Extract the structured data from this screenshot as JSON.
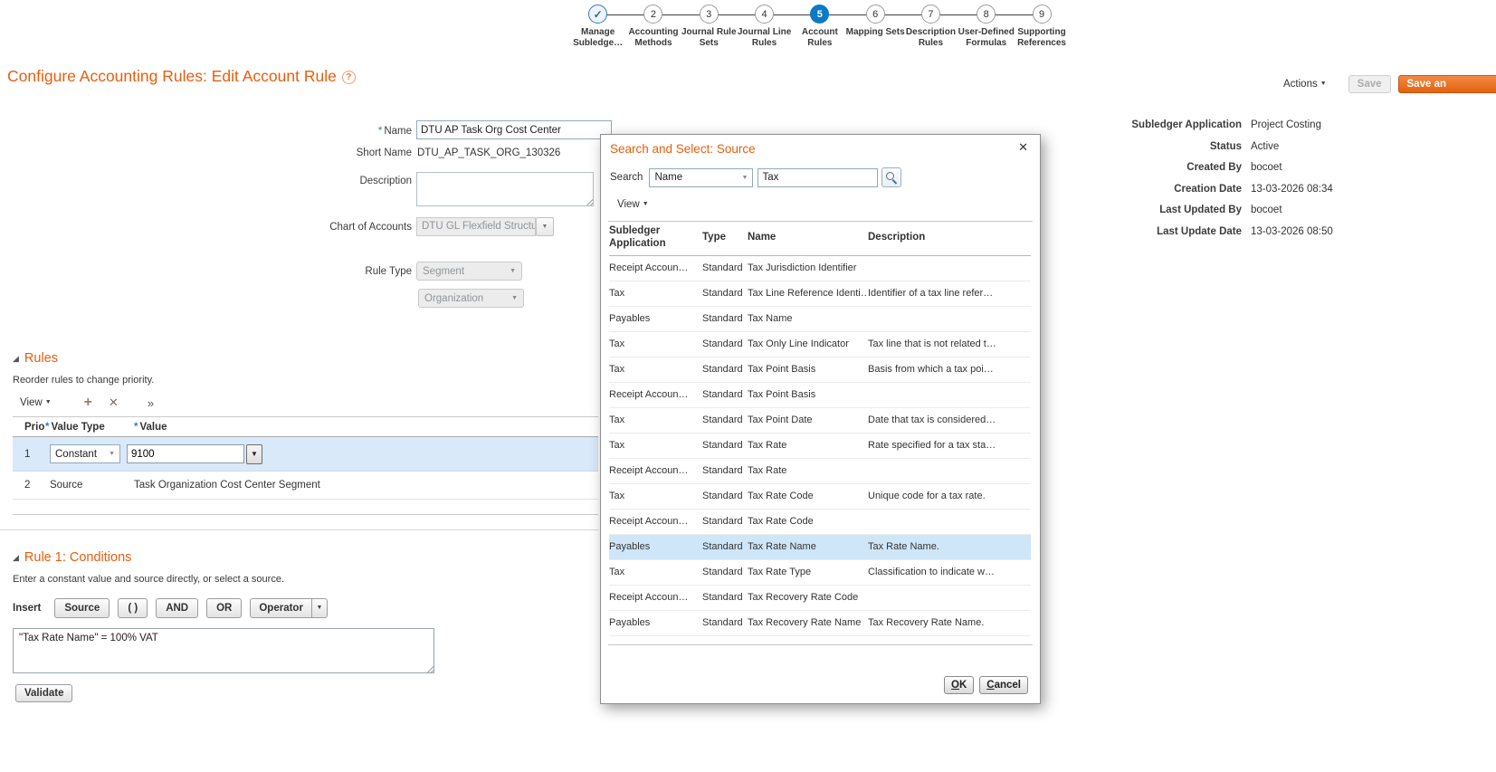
{
  "icons": {
    "check": "✓",
    "close": "✕",
    "add": "+",
    "delete": "✕",
    "more": "»",
    "dropdown": "▼",
    "help": "?",
    "disclosure": "◢"
  },
  "colors": {
    "accent_orange": "#EA5D0D",
    "active_step_blue": "#0B79C6",
    "selected_row_blue": "#D9E9F9",
    "primary_button_orange": "#E4610E"
  },
  "required_marker": "*",
  "stepper": {
    "steps": [
      {
        "num": "1",
        "label": "Manage Subledge…",
        "state": "completed"
      },
      {
        "num": "2",
        "label": "Accounting Methods",
        "state": "default"
      },
      {
        "num": "3",
        "label": "Journal Rule Sets",
        "state": "default"
      },
      {
        "num": "4",
        "label": "Journal Line Rules",
        "state": "default"
      },
      {
        "num": "5",
        "label": "Account Rules",
        "state": "active"
      },
      {
        "num": "6",
        "label": "Mapping Sets",
        "state": "default"
      },
      {
        "num": "7",
        "label": "Description Rules",
        "state": "default"
      },
      {
        "num": "8",
        "label": "User-Defined Formulas",
        "state": "default"
      },
      {
        "num": "9",
        "label": "Supporting References",
        "state": "default"
      }
    ]
  },
  "header": {
    "title": "Configure Accounting Rules: Edit Account Rule",
    "actions_label": "Actions",
    "save_label": "Save",
    "save_and_label": "Save an"
  },
  "form": {
    "name_label": "Name",
    "name_value": "DTU AP Task Org Cost Center",
    "short_name_label": "Short Name",
    "short_name_value": "DTU_AP_TASK_ORG_130326",
    "description_label": "Description",
    "description_value": "",
    "chart_label": "Chart of Accounts",
    "chart_value": "DTU GL Flexfield Structure",
    "rule_type_label": "Rule Type",
    "rule_type_value": "Segment",
    "rule_type_sub_value": "Organization"
  },
  "summary": {
    "rows": [
      {
        "label": "Subledger Application",
        "value": "Project Costing"
      },
      {
        "label": "Status",
        "value": "Active"
      },
      {
        "label": "Created By",
        "value": "bocoet"
      },
      {
        "label": "Creation Date",
        "value": "13-03-2026 08:34"
      },
      {
        "label": "Last Updated By",
        "value": "bocoet"
      },
      {
        "label": "Last Update Date",
        "value": "13-03-2026 08:50"
      }
    ]
  },
  "rules": {
    "title": "Rules",
    "hint": "Reorder rules to change priority.",
    "view_label": "View",
    "columns": {
      "prio": "Prio",
      "value_type": "Value Type",
      "value": "Value"
    },
    "rows": [
      {
        "prio": "1",
        "value_type": "Constant",
        "value": "9100",
        "selected": true
      },
      {
        "prio": "2",
        "value_type": "Source",
        "value": "Task Organization Cost Center Segment",
        "selected": false
      }
    ]
  },
  "conditions": {
    "title": "Rule 1: Conditions",
    "hint": "Enter a constant value and source directly, or select a source.",
    "insert_label": "Insert",
    "buttons": [
      "Source",
      "( )",
      "AND",
      "OR",
      "Operator"
    ],
    "expression": "\"Tax Rate Name\" = 100% VAT",
    "validate_label": "Validate"
  },
  "dialog": {
    "title": "Search and Select: Source",
    "search_label": "Search",
    "search_field_value": "Name",
    "search_input_value": "Tax",
    "view_label": "View",
    "columns": [
      "Subledger Application",
      "Type",
      "Name",
      "Description"
    ],
    "rows": [
      {
        "app": "Receipt Accoun…",
        "type": "Standard",
        "name": "Tax Jurisdiction Identifier",
        "desc": ""
      },
      {
        "app": "Tax",
        "type": "Standard",
        "name": "Tax Line Reference Identi…",
        "desc": "Identifier of a tax line refer…"
      },
      {
        "app": "Payables",
        "type": "Standard",
        "name": "Tax Name",
        "desc": ""
      },
      {
        "app": "Tax",
        "type": "Standard",
        "name": "Tax Only Line Indicator",
        "desc": "Tax line that is not related t…"
      },
      {
        "app": "Tax",
        "type": "Standard",
        "name": "Tax Point Basis",
        "desc": "Basis from which a tax poi…"
      },
      {
        "app": "Receipt Accoun…",
        "type": "Standard",
        "name": "Tax Point Basis",
        "desc": ""
      },
      {
        "app": "Tax",
        "type": "Standard",
        "name": "Tax Point Date",
        "desc": "Date that tax is considered…"
      },
      {
        "app": "Tax",
        "type": "Standard",
        "name": "Tax Rate",
        "desc": "Rate specified for a tax sta…"
      },
      {
        "app": "Receipt Accoun…",
        "type": "Standard",
        "name": "Tax Rate",
        "desc": ""
      },
      {
        "app": "Tax",
        "type": "Standard",
        "name": "Tax Rate Code",
        "desc": "Unique code for a tax rate."
      },
      {
        "app": "Receipt Accoun…",
        "type": "Standard",
        "name": "Tax Rate Code",
        "desc": ""
      },
      {
        "app": "Payables",
        "type": "Standard",
        "name": "Tax Rate Name",
        "desc": "Tax Rate Name.",
        "selected": true
      },
      {
        "app": "Tax",
        "type": "Standard",
        "name": "Tax Rate Type",
        "desc": "Classification to indicate w…"
      },
      {
        "app": "Receipt Accoun…",
        "type": "Standard",
        "name": "Tax Recovery Rate Code",
        "desc": ""
      },
      {
        "app": "Payables",
        "type": "Standard",
        "name": "Tax Recovery Rate Name",
        "desc": "Tax Recovery Rate Name."
      }
    ],
    "ok_label": "OK",
    "cancel_label": "Cancel"
  }
}
